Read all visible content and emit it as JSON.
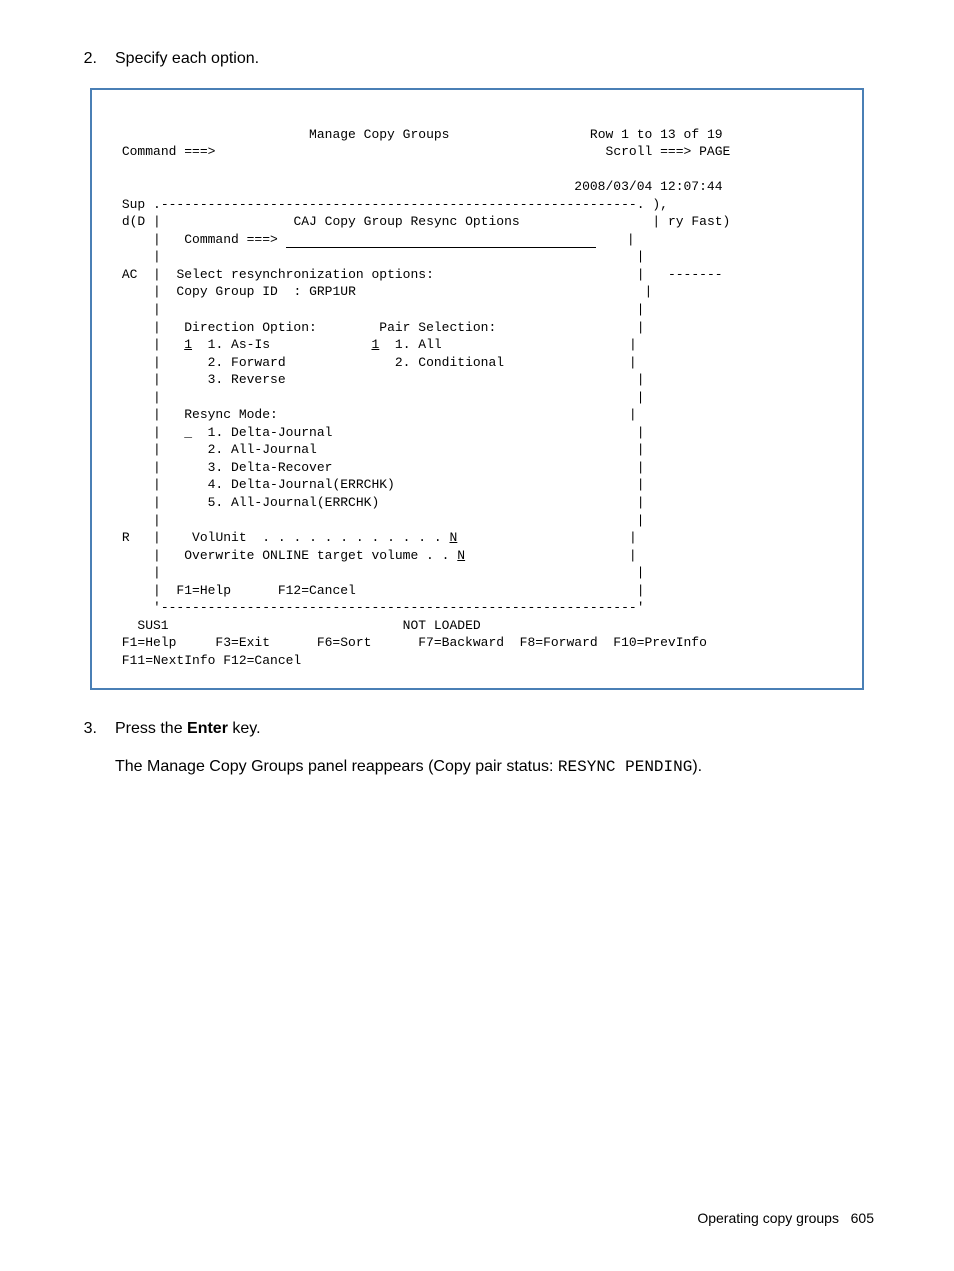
{
  "step2": {
    "number": "2.",
    "text": "Specify each option."
  },
  "terminal": {
    "title": "Manage Copy Groups",
    "rowinfo": "Row 1 to 13 of 19",
    "cmd_label_outer": "Command ===>",
    "scroll": "Scroll ===> PAGE",
    "timestamp": "2008/03/04 12:07:44",
    "col_sup": "Sup",
    "col_dd": "d(D",
    "border_top": ".-------------------------------------------------------------.",
    "border_right": "),",
    "popup_title": "CAJ Copy Group Resync Options",
    "ry_fast": "ry Fast)",
    "cmd_label_inner": "Command ===>",
    "ac": "AC",
    "select_msg": "Select resynchronization options:",
    "dashes": "-------",
    "copy_group_id_label": "Copy Group ID  :",
    "copy_group_id": "GRP1UR",
    "direction_label": "Direction Option:",
    "pair_label": "Pair Selection:",
    "dir_val": "1",
    "dir_opt1": "1. As-Is",
    "pair_val": "1",
    "pair_opt1": "1. All",
    "dir_opt2": "2. Forward",
    "pair_opt2": "2. Conditional",
    "dir_opt3": "3. Reverse",
    "resync_label": "Resync Mode:",
    "resync_val": "_",
    "resync_opt1": "1. Delta-Journal",
    "resync_opt2": "2. All-Journal",
    "resync_opt3": "3. Delta-Recover",
    "resync_opt4": "4. Delta-Journal(ERRCHK)",
    "resync_opt5": "5. All-Journal(ERRCHK)",
    "r_label": "R",
    "volunit_label": "VolUnit  . . . . . . . . . . . .",
    "volunit_val": "N",
    "overwrite_label": "Overwrite ONLINE target volume . .",
    "overwrite_val": "N",
    "popup_keys": "  F1=Help      F12=Cancel",
    "border_bottom": "'-------------------------------------------------------------'",
    "sus1": "SUS1",
    "not_loaded": "NOT LOADED",
    "main_keys1": " F1=Help     F3=Exit      F6=Sort      F7=Backward  F8=Forward  F10=PrevInfo",
    "main_keys2": " F11=NextInfo F12=Cancel"
  },
  "step3": {
    "number": "3.",
    "text1_pre": "Press the ",
    "enter": "Enter",
    "text1_post": " key.",
    "text2_pre": "The Manage Copy Groups panel reappears (Copy pair status: ",
    "status": "RESYNC PENDING",
    "text2_post": ")."
  },
  "footer": {
    "label": "Operating copy groups",
    "page": "605"
  }
}
